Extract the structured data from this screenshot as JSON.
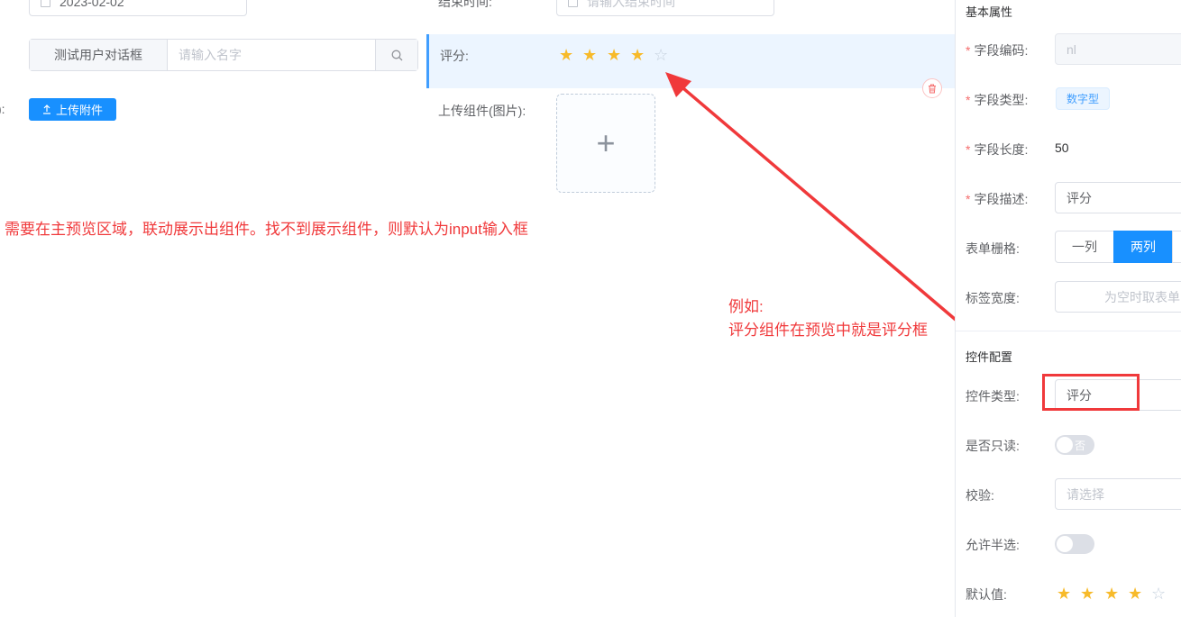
{
  "left": {
    "date_value": "2023-02-02",
    "dialog_button": "测试用户对话框",
    "name_placeholder": "请输入名字",
    "row3_label_tail": "):",
    "upload_attachment": "上传附件"
  },
  "middle": {
    "end_time_label": "结束时间:",
    "end_time_placeholder": "请输入结束时间",
    "rate_label": "评分:",
    "rate_value": 4,
    "rate_max": 5,
    "upload_image_label": "上传组件(图片):",
    "plus_glyph": "+"
  },
  "annotation": {
    "main_note": "需要在主预览区域，联动展示出组件。找不到展示组件，则默认为input输入框",
    "example_line1": "例如:",
    "example_line2": "评分组件在预览中就是评分框",
    "color": "#f0393b"
  },
  "panel": {
    "basic_title": "基本属性",
    "field_code_label": "字段编码:",
    "field_code_value": "nl",
    "field_type_label": "字段类型:",
    "field_type_tag": "数字型",
    "field_length_label": "字段长度:",
    "field_length_value": "50",
    "field_desc_label": "字段描述:",
    "field_desc_value": "评分",
    "grid_label": "表单栅格:",
    "grid_one": "一列",
    "grid_two": "两列",
    "label_width_label": "标签宽度:",
    "label_width_placeholder": "为空时取表单",
    "control_title": "控件配置",
    "control_type_label": "控件类型:",
    "control_type_value": "评分",
    "readonly_label": "是否只读:",
    "readonly_text": "否",
    "validate_label": "校验:",
    "validate_placeholder": "请选择",
    "half_label": "允许半选:",
    "default_label": "默认值:",
    "default_rate": 4
  },
  "colors": {
    "primary": "#1890ff",
    "star_on": "#f7ba2a",
    "star_off": "#c6d1de",
    "selected_bg": "#ecf5ff",
    "danger": "#f56c6c"
  },
  "icons": [
    "calendar-icon",
    "search-icon",
    "upload-icon",
    "delete-icon",
    "plus-icon",
    "star-icon"
  ]
}
